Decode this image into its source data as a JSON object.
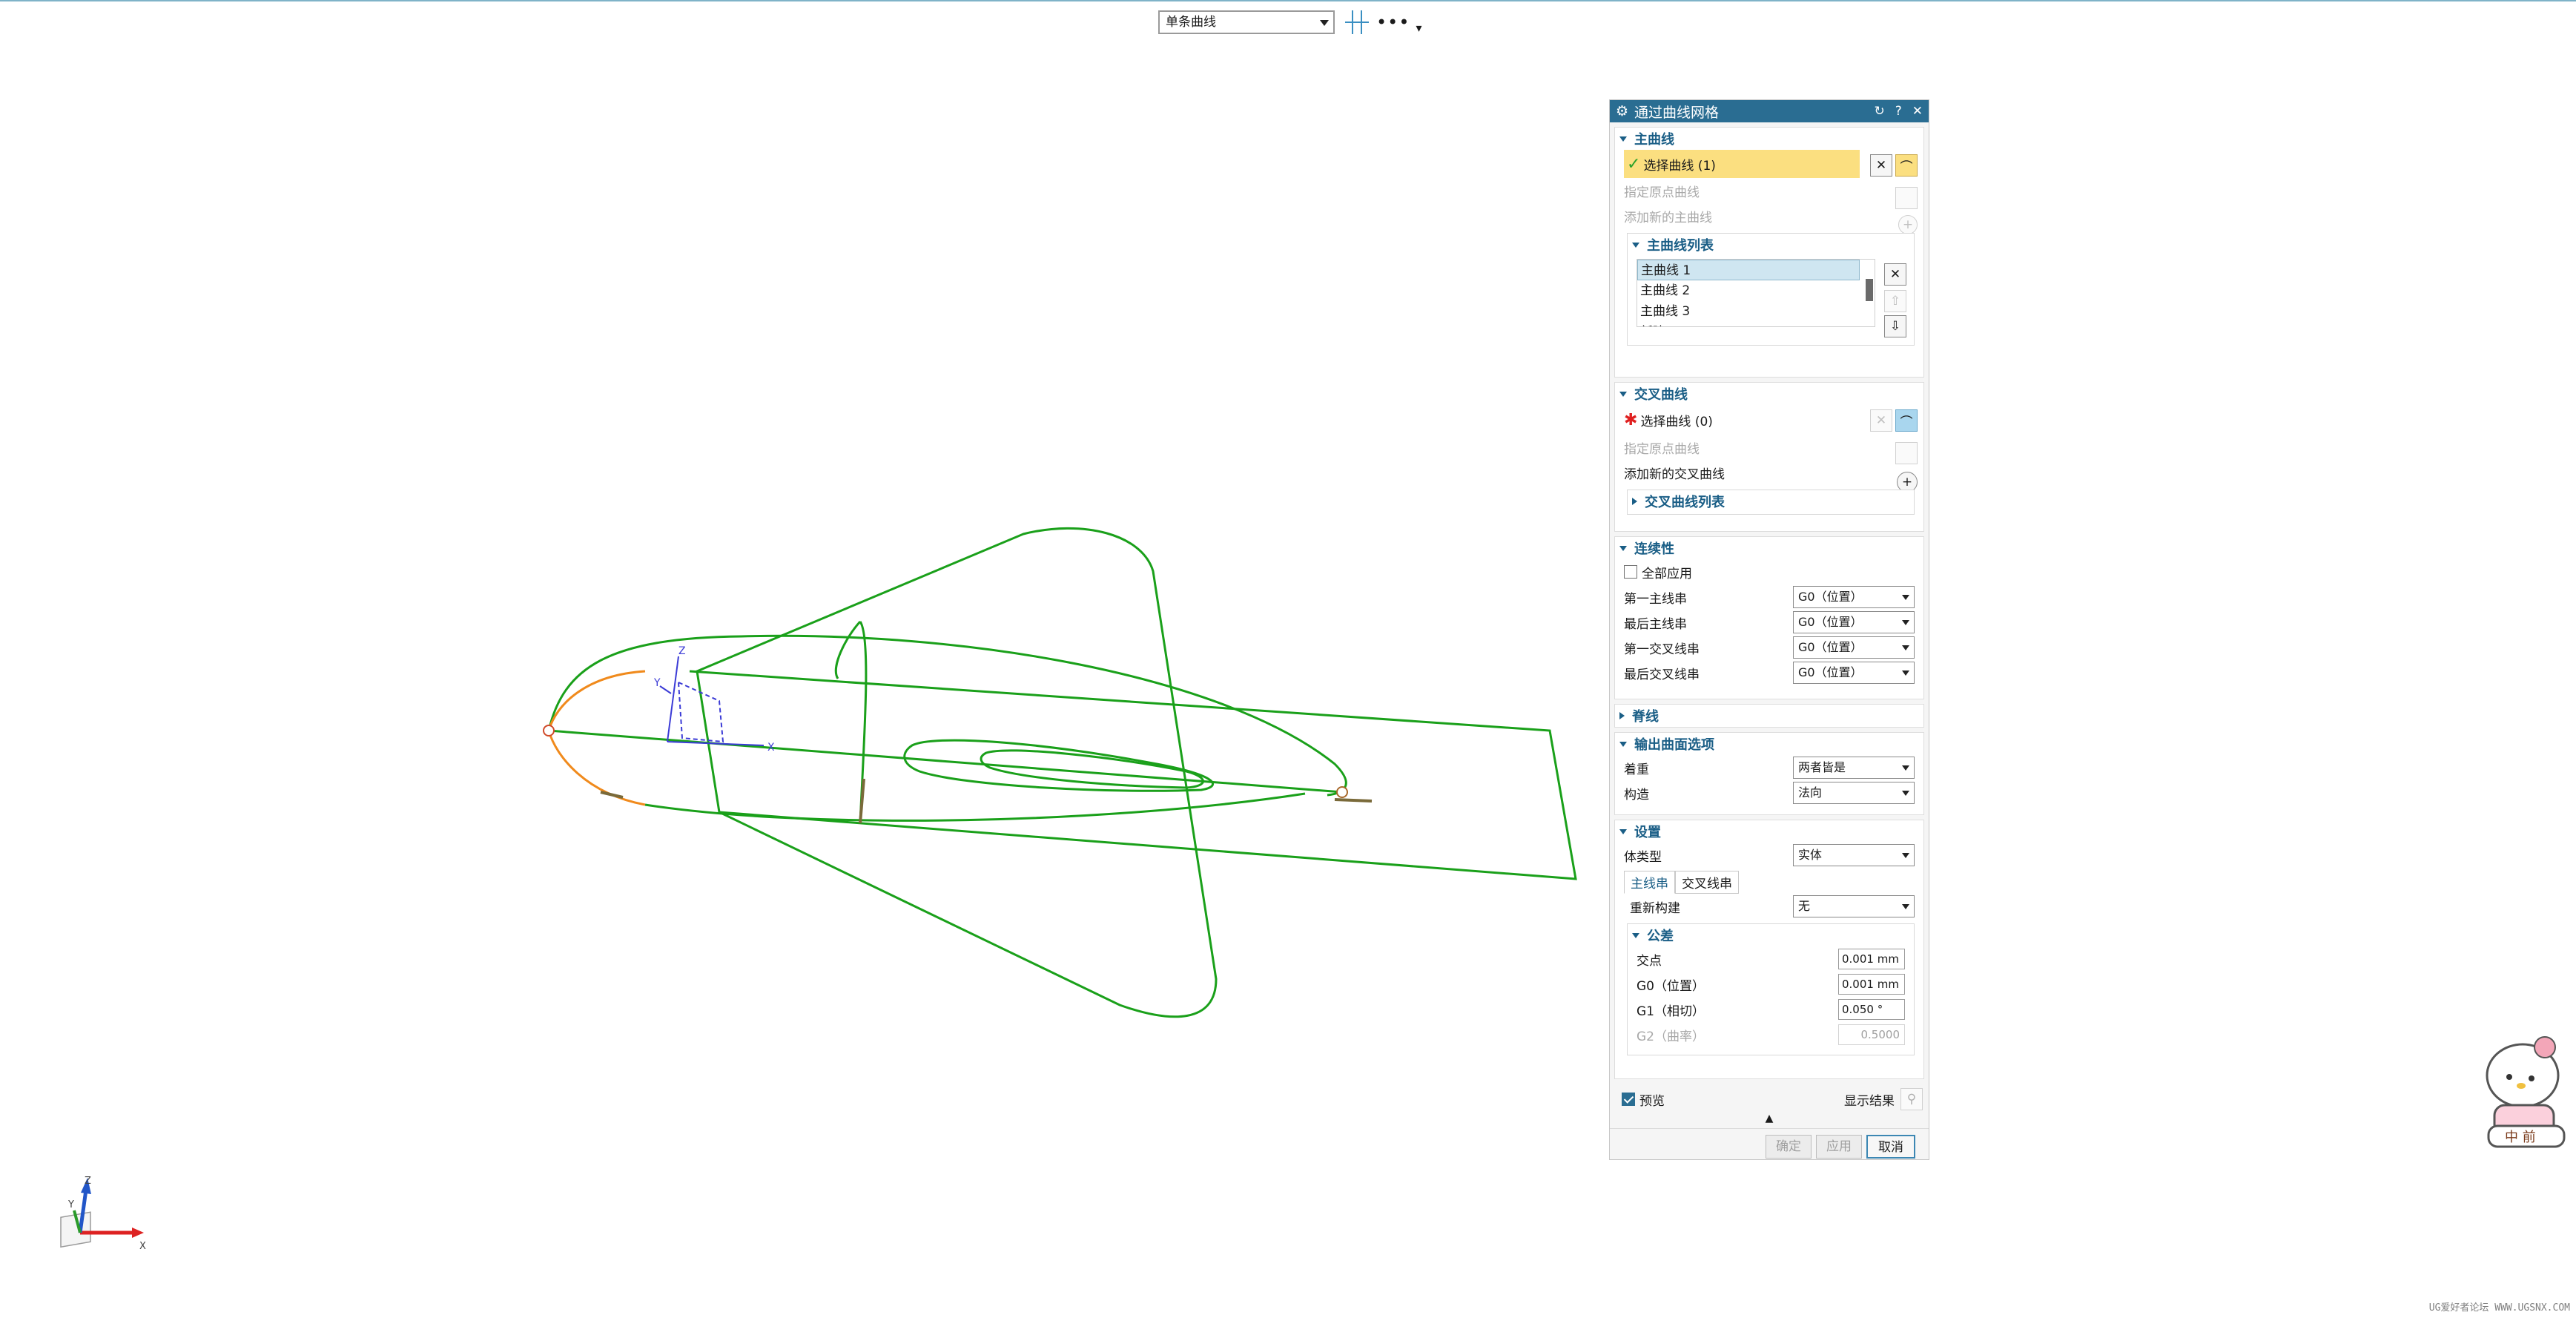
{
  "toolbar": {
    "filter_value": "单条曲线",
    "more_label": "•••"
  },
  "dialog": {
    "title": "通过曲线网格",
    "primary_curves": {
      "header": "主曲线",
      "select_label": "选择曲线 (1)",
      "specify_origin": "指定原点曲线",
      "add_new": "添加新的主曲线",
      "list_header": "主曲线列表",
      "list_items": [
        "主曲线 1",
        "主曲线 2",
        "主曲线 3",
        "新建"
      ]
    },
    "cross_curves": {
      "header": "交叉曲线",
      "select_label": "选择曲线 (0)",
      "specify_origin": "指定原点曲线",
      "add_new": "添加新的交叉曲线",
      "list_header": "交叉曲线列表"
    },
    "continuity": {
      "header": "连续性",
      "apply_all": "全部应用",
      "rows": [
        {
          "label": "第一主线串",
          "value": "G0（位置）"
        },
        {
          "label": "最后主线串",
          "value": "G0（位置）"
        },
        {
          "label": "第一交叉线串",
          "value": "G0（位置）"
        },
        {
          "label": "最后交叉线串",
          "value": "G0（位置）"
        }
      ]
    },
    "spine": {
      "header": "脊线"
    },
    "output": {
      "header": "输出曲面选项",
      "emphasis_label": "着重",
      "emphasis_value": "两者皆是",
      "construction_label": "构造",
      "construction_value": "法向"
    },
    "settings": {
      "header": "设置",
      "body_type_label": "体类型",
      "body_type_value": "实体",
      "tab_primary": "主线串",
      "tab_cross": "交叉线串",
      "rebuild_label": "重新构建",
      "rebuild_value": "无",
      "tolerance_header": "公差",
      "tolerance": [
        {
          "label": "交点",
          "value": "0.001 mm"
        },
        {
          "label": "G0（位置）",
          "value": "0.001 mm"
        },
        {
          "label": "G1（相切）",
          "value": "0.050 °"
        },
        {
          "label": "G2（曲率）",
          "value": "0.5000"
        }
      ]
    },
    "preview_label": "预览",
    "show_result_label": "显示结果",
    "ok_label": "确定",
    "apply_label": "应用",
    "cancel_label": "取消"
  },
  "viewport": {
    "wcs_x": "X",
    "wcs_y": "Y",
    "wcs_z": "Z",
    "triad_x": "X",
    "triad_y": "Y",
    "triad_z": "Z"
  },
  "watermark": "UG爱好者论坛 WWW.UGSNX.COM",
  "colors": {
    "accent": "#2a6d92",
    "wireframe": "#1aa01a",
    "highlight_curve": "#f08a1c",
    "selection_yellow": "#fbdf80"
  }
}
